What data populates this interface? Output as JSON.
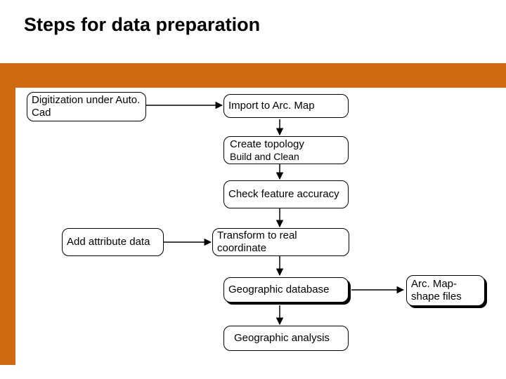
{
  "title": "Steps for data preparation",
  "nodes": {
    "digitization": "Digitization under Auto. Cad",
    "import": "Import to Arc. Map",
    "topology_l1": "Create topology",
    "topology_l2": "Build and Clean",
    "check": "Check feature accuracy",
    "add_attr": "Add attribute data",
    "transform": "Transform to real coordinate",
    "geodb": "Geographic database",
    "shape": "Arc. Map-shape files",
    "analysis": "Geographic analysis"
  },
  "colors": {
    "bar": "#CF6A10"
  }
}
